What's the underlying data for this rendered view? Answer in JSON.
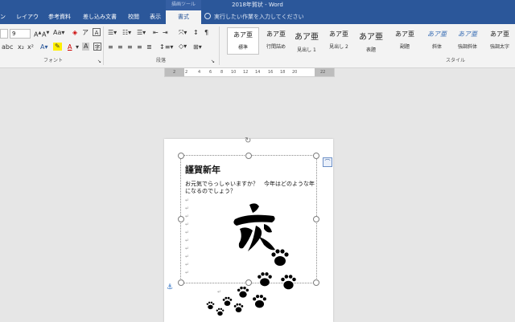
{
  "titlebar": {
    "context_tool": "描画ツール",
    "title": "2018年賀状 - Word"
  },
  "tabs": [
    {
      "label": "ン"
    },
    {
      "label": "レイアウト"
    },
    {
      "label": "参考資料"
    },
    {
      "label": "差し込み文書"
    },
    {
      "label": "校閲"
    },
    {
      "label": "表示"
    },
    {
      "label": "書式"
    }
  ],
  "tellme": "実行したい作業を入力してください",
  "ribbon": {
    "font_size": "9",
    "groups": {
      "font": "フォント",
      "paragraph": "段落",
      "styles": "スタイル"
    },
    "styles": [
      {
        "sample": "あア亜",
        "name": "標準"
      },
      {
        "sample": "あア亜",
        "name": "行間詰め"
      },
      {
        "sample": "あア亜",
        "name": "見出し 1"
      },
      {
        "sample": "あア亜",
        "name": "見出し 2"
      },
      {
        "sample": "あア亜",
        "name": "表題"
      },
      {
        "sample": "あア亜",
        "name": "副題"
      },
      {
        "sample": "あア亜",
        "name": "斜体"
      },
      {
        "sample": "あア亜",
        "name": "強調斜体"
      },
      {
        "sample": "あア亜",
        "name": "強調太字"
      }
    ]
  },
  "ruler_ticks": [
    "2",
    "2",
    "4",
    "6",
    "8",
    "10",
    "12",
    "14",
    "16",
    "18",
    "20",
    "22"
  ],
  "document": {
    "greeting": "謹賀新年",
    "pilcrow": "↵",
    "line1": "お元気でらっしゃいますか？　今年はどのような年",
    "line2": "になるのでしょう？"
  },
  "kanji_label": "亥"
}
